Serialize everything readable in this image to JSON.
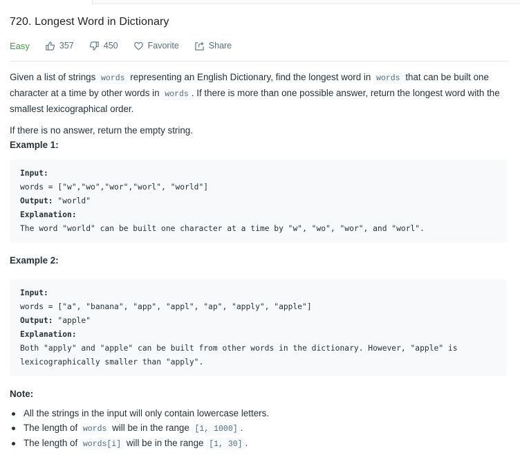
{
  "header": {
    "title": "720. Longest Word in Dictionary",
    "difficulty": "Easy",
    "difficulty_color": "#43a047",
    "likes": "357",
    "dislikes": "450",
    "favorite_label": "Favorite",
    "share_label": "Share",
    "icons": {
      "like": "thumbs-up-icon",
      "dislike": "thumbs-down-icon",
      "favorite": "heart-icon",
      "share": "share-icon"
    }
  },
  "description": {
    "p1": {
      "t1": "Given a list of strings ",
      "c1": "words",
      "t2": " representing an English Dictionary, find the longest word in ",
      "c2": "words",
      "t3": " that can be built one character at a time by other words in ",
      "c3": "words",
      "t4": ". If there is more than one possible answer, return the longest word with the smallest lexicographical order."
    },
    "p2": "If there is no answer, return the empty string."
  },
  "examples": [
    {
      "heading": "Example 1:",
      "input_label": "Input:",
      "input_value": "words = [\"w\",\"wo\",\"wor\",\"worl\", \"world\"]",
      "output_label": "Output:",
      "output_value": " \"world\"",
      "explanation_label": "Explanation:",
      "explanation_text": "The word \"world\" can be built one character at a time by \"w\", \"wo\", \"wor\", and \"worl\"."
    },
    {
      "heading": "Example 2:",
      "input_label": "Input:",
      "input_value": "words = [\"a\", \"banana\", \"app\", \"appl\", \"ap\", \"apply\", \"apple\"]",
      "output_label": "Output:",
      "output_value": " \"apple\"",
      "explanation_label": "Explanation:",
      "explanation_text": "Both \"apply\" and \"apple\" can be built from other words in the dictionary. However, \"apple\" is lexicographically smaller than \"apply\"."
    }
  ],
  "note": {
    "heading": "Note:",
    "items": [
      {
        "t1": "All the strings in the input will only contain lowercase letters."
      },
      {
        "t1": "The length of ",
        "c1": "words",
        "t2": " will be in the range ",
        "c2": "[1, 1000]",
        "t3": "."
      },
      {
        "t1": "The length of ",
        "c1": "words[i]",
        "t2": " will be in the range ",
        "c2": "[1, 30]",
        "t3": "."
      }
    ]
  }
}
